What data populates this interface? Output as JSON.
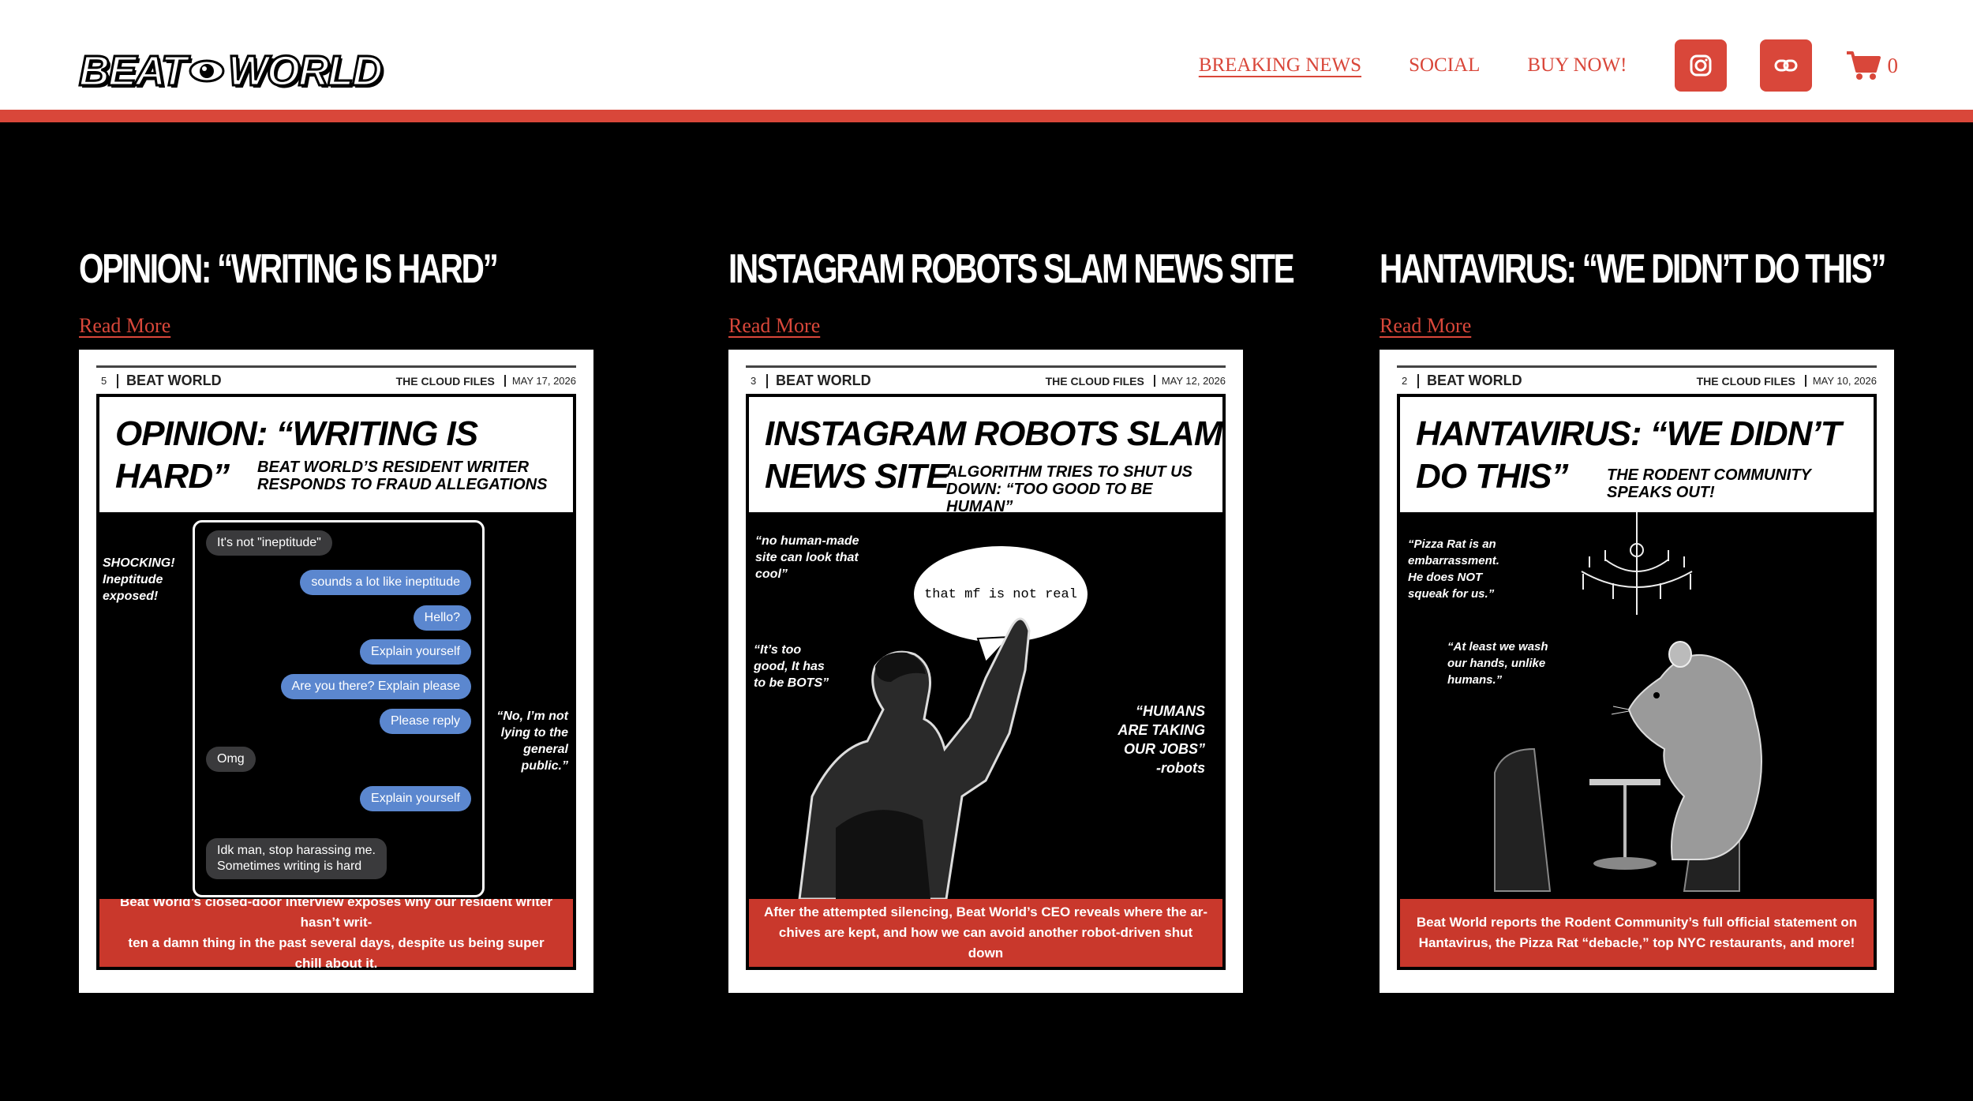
{
  "header": {
    "logo_left": "BEAT",
    "logo_right": "WORLD",
    "nav": [
      {
        "label": "BREAKING NEWS",
        "active": true
      },
      {
        "label": "SOCIAL",
        "active": false
      },
      {
        "label": "BUY NOW!",
        "active": false
      }
    ],
    "cart_count": "0",
    "icons": [
      "instagram-icon",
      "link-icon",
      "cart-icon"
    ],
    "accent_color": "#d9473a"
  },
  "articles": [
    {
      "title": "OPINION: “WRITING IS HARD”",
      "read_more": "Read More",
      "card": {
        "page": "5",
        "brand": "BEAT WORLD",
        "section": "THE CLOUD FILES",
        "date": "MAY 17, 2026",
        "headline": "OPINION: “WRITING IS HARD”",
        "subhead": "BEAT WORLD’S RESIDENT WRITER\nRESPONDS TO FRAUD ALLEGATIONS",
        "quotes": [
          "SHOCKING!\nIneptitude\nexposed!",
          "“No, I’m not\nlying to the\ngeneral\npublic.”"
        ],
        "chat": [
          {
            "dir": "in",
            "text": "It's not \"ineptitude\""
          },
          {
            "dir": "out",
            "text": "sounds a lot like ineptitude"
          },
          {
            "dir": "out",
            "text": "Hello?"
          },
          {
            "dir": "out",
            "text": "Explain yourself"
          },
          {
            "dir": "out",
            "text": "Are you there? Explain please"
          },
          {
            "dir": "out",
            "text": "Please reply"
          },
          {
            "dir": "in",
            "text": "Omg"
          },
          {
            "dir": "out",
            "text": "Explain yourself"
          },
          {
            "dir": "in",
            "text": "Idk man, stop harassing me.\nSometimes writing is hard"
          }
        ],
        "footer": "Beat World’s closed-door interview exposes why our resident writer hasn’t writ-\nten a damn thing in the past several days, despite us being super chill about it."
      }
    },
    {
      "title": "INSTAGRAM ROBOTS SLAM NEWS SITE",
      "read_more": "Read More",
      "card": {
        "page": "3",
        "brand": "BEAT WORLD",
        "section": "THE CLOUD FILES",
        "date": "MAY 12, 2026",
        "headline": "INSTAGRAM ROBOTS SLAM\nNEWS SITE",
        "subhead": "ALGORITHM TRIES TO SHUT US\nDOWN: “TOO GOOD TO BE HUMAN”",
        "quotes": [
          "“no human-made\nsite can look that\ncool”",
          "“It’s too\ngood, It has\nto be BOTS”",
          "“HUMANS\nARE TAKING\nOUR JOBS”\n-robots"
        ],
        "speech": "that mf is not real",
        "footer": "After the attempted silencing, Beat World’s CEO reveals where the ar-\nchives are kept, and how we can avoid another robot-driven shut down"
      }
    },
    {
      "title": "HANTAVIRUS: “WE DIDN’T DO THIS”",
      "read_more": "Read More",
      "card": {
        "page": "2",
        "brand": "BEAT WORLD",
        "section": "THE CLOUD FILES",
        "date": "MAY 10, 2026",
        "headline": "HANTAVIRUS: “WE DIDN’T\nDO THIS”",
        "subhead": "THE RODENT COMMUNITY\nSPEAKS OUT!",
        "quotes": [
          "“Pizza Rat is an\nembarrassment.\nHe does NOT\nsqueak for us.”",
          "“At least we wash\nour hands, unlike\nhumans.”"
        ],
        "footer": "Beat World reports the Rodent Community’s full official statement on\nHantavirus, the Pizza Rat “debacle,” top NYC restaurants, and more!"
      }
    }
  ]
}
